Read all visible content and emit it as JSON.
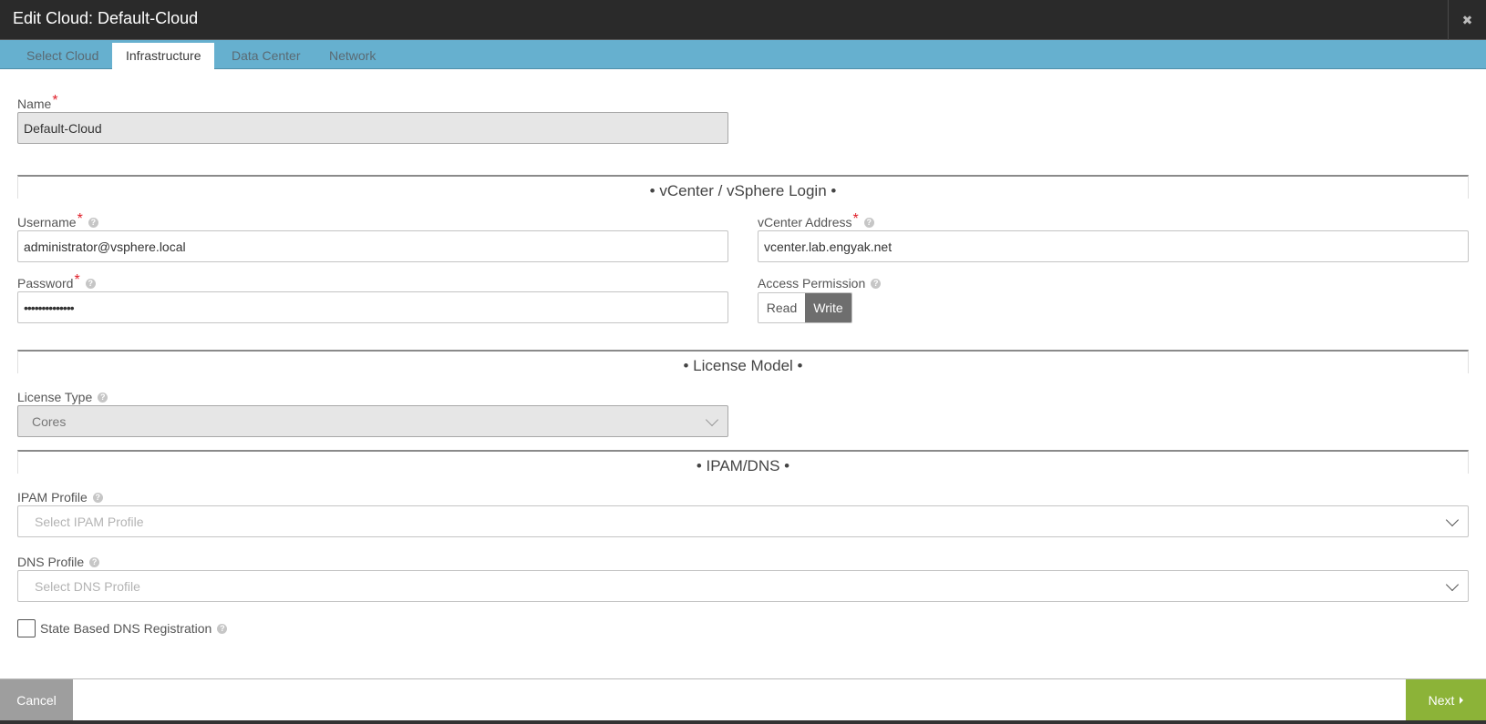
{
  "dialog": {
    "title": "Edit Cloud: Default-Cloud",
    "close_glyph": "✖"
  },
  "tabs": [
    {
      "label": "Select Cloud"
    },
    {
      "label": "Infrastructure"
    },
    {
      "label": "Data Center"
    },
    {
      "label": "Network"
    }
  ],
  "name_field": {
    "label": "Name",
    "required_mark": "*",
    "value": "Default-Cloud"
  },
  "sections": {
    "vcenter": "• vCenter / vSphere Login •",
    "license": "• License Model •",
    "ipam_dns": "• IPAM/DNS •"
  },
  "username": {
    "label": "Username",
    "required_mark": "*",
    "value": "administrator@vsphere.local"
  },
  "vcenter_address": {
    "label": "vCenter Address",
    "required_mark": "*",
    "value": "vcenter.lab.engyak.net"
  },
  "password": {
    "label": "Password",
    "required_mark": "*",
    "value": "••••••••••••••"
  },
  "access_permission": {
    "label": "Access Permission",
    "options": [
      "Read",
      "Write"
    ],
    "selected": "Write"
  },
  "license_type": {
    "label": "License Type",
    "value": "Cores"
  },
  "ipam_profile": {
    "label": "IPAM Profile",
    "placeholder": "Select IPAM Profile"
  },
  "dns_profile": {
    "label": "DNS Profile",
    "placeholder": "Select DNS Profile"
  },
  "state_dns": {
    "label": "State Based DNS Registration",
    "checked": false
  },
  "footer": {
    "cancel_label": "Cancel",
    "next_label": "Next"
  },
  "icons": {
    "help": "help-icon",
    "chevron": "chevron-down-icon",
    "close": "close-icon",
    "next_arrow": "caret-right-icon"
  },
  "colors": {
    "title_bar": "#2a2a2a",
    "tab_bar": "#66b0cf",
    "next_button": "#8cb338",
    "cancel_button": "#9e9e9e",
    "required": "#e0202a"
  }
}
